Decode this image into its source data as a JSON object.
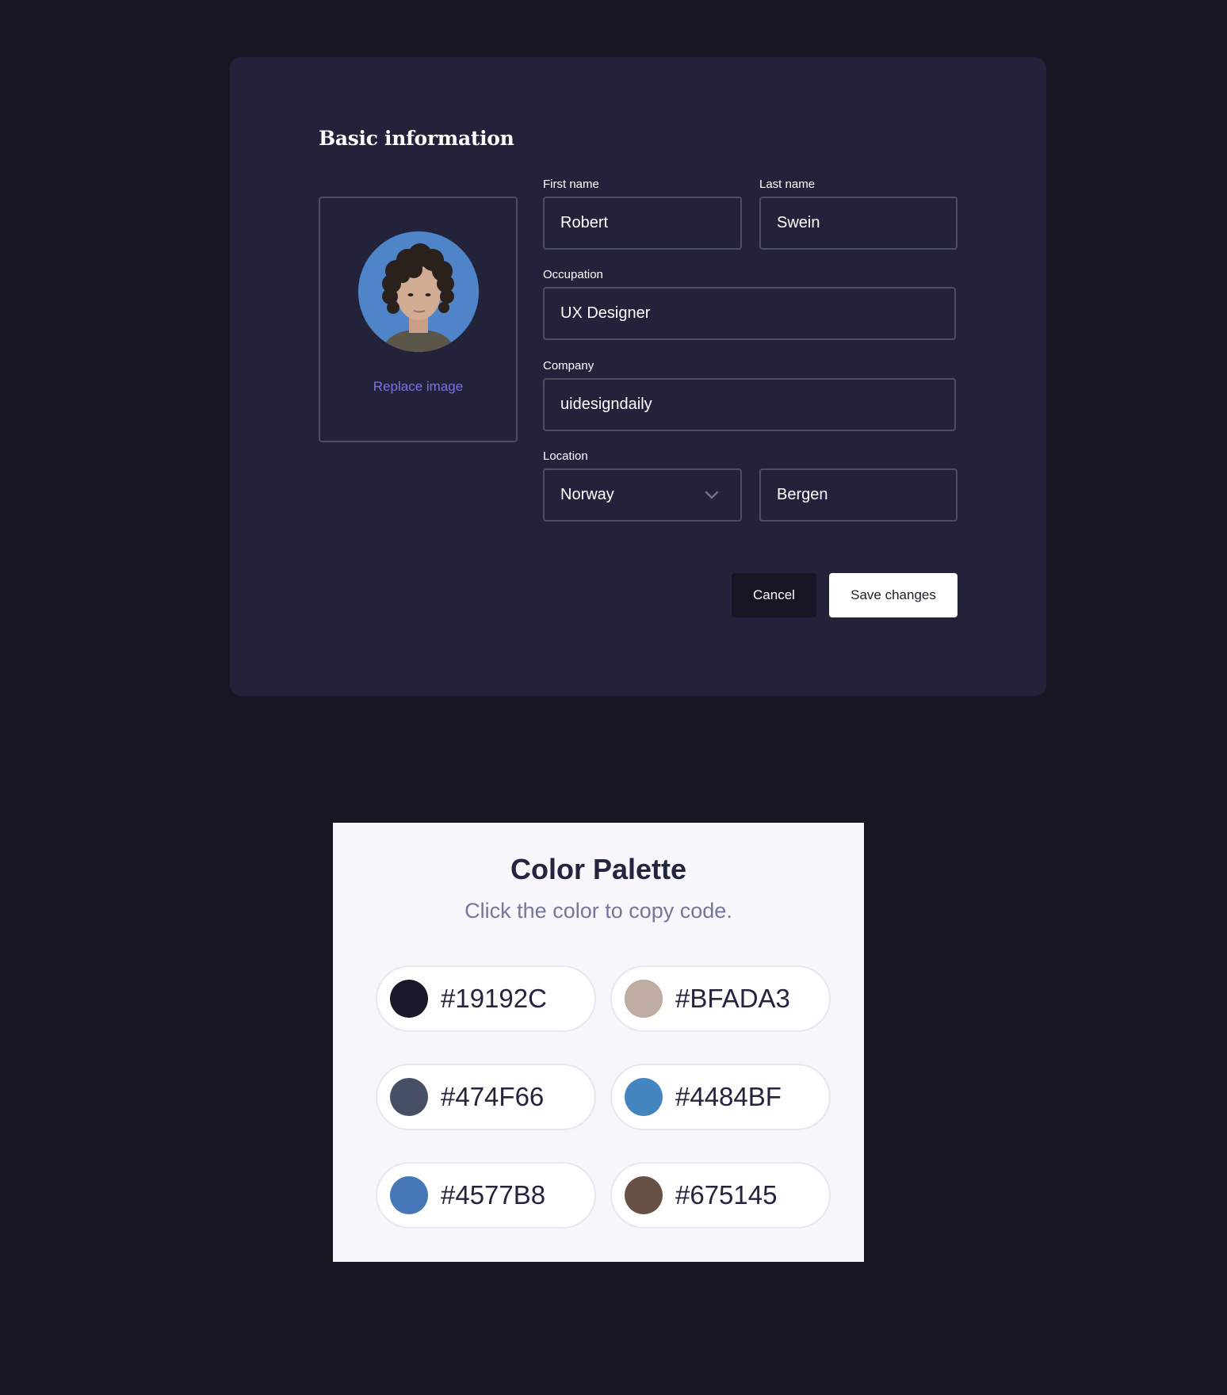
{
  "form": {
    "title": "Basic information",
    "avatar": {
      "alt": "profile photo",
      "bg_color": "#4F84C8"
    },
    "replace_image_label": "Replace image",
    "first_name": {
      "label": "First name",
      "value": "Robert"
    },
    "last_name": {
      "label": "Last name",
      "value": "Swein"
    },
    "occupation": {
      "label": "Occupation",
      "value": "UX Designer"
    },
    "company": {
      "label": "Company",
      "value": "uidesigndaily"
    },
    "location": {
      "label": "Location",
      "country": "Norway",
      "city": "Bergen",
      "country_icon": "chevron-down-icon"
    },
    "cancel_label": "Cancel",
    "save_label": "Save changes"
  },
  "palette": {
    "title": "Color Palette",
    "subtitle": "Click the color to copy code.",
    "swatches": [
      {
        "code": "#19192C",
        "color": "#19192C"
      },
      {
        "code": "#BFADA3",
        "color": "#BFADA3"
      },
      {
        "code": "#474F66",
        "color": "#474F66"
      },
      {
        "code": "#4484BF",
        "color": "#4484BF"
      },
      {
        "code": "#4577B8",
        "color": "#4577B8"
      },
      {
        "code": "#675145",
        "color": "#675145"
      }
    ]
  },
  "colors": {
    "page_bg": "#171724",
    "card_bg": "#22233A",
    "link": "#7A73E0",
    "save_bg": "#FFFFFF",
    "cancel_bg": "#151624"
  }
}
